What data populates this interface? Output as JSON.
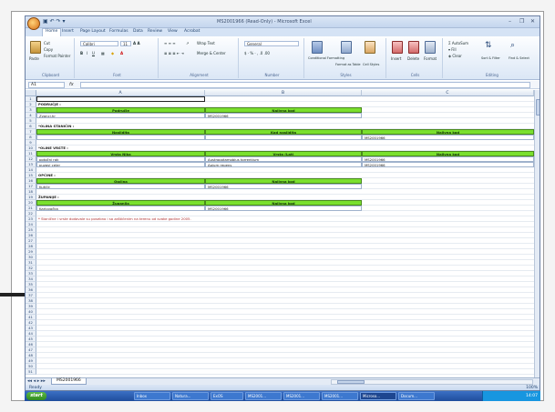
{
  "window": {
    "title": "MS2001966 (Read-Only) - Microsoft Excel",
    "quick_access": "▣ ↶ ↷ ▾",
    "controls": [
      "–",
      "❐",
      "✕"
    ]
  },
  "ribbon_tabs": [
    "Home",
    "Insert",
    "Page Layout",
    "Formulas",
    "Data",
    "Review",
    "View",
    "Acrobat"
  ],
  "ribbon": {
    "clipboard": {
      "paste": "Paste",
      "cut": "Cut",
      "copy": "Copy",
      "format_painter": "Format Painter",
      "label": "Clipboard"
    },
    "font": {
      "name": "Calibri",
      "size": "11",
      "label": "Font"
    },
    "alignment": {
      "wrap": "Wrap Text",
      "merge": "Merge & Center",
      "label": "Alignment"
    },
    "number": {
      "format": "General",
      "label": "Number"
    },
    "styles": {
      "conditional": "Conditional Formatting",
      "format_table": "Format as Table",
      "cell_styles": "Cell Styles",
      "label": "Styles"
    },
    "cells": {
      "insert": "Insert",
      "delete": "Delete",
      "format": "Format",
      "label": "Cells"
    },
    "editing": {
      "autosum": "AutoSum",
      "fill": "Fill",
      "clear": "Clear",
      "sort": "Sort & Filter",
      "find": "Find & Select",
      "label": "Editing"
    }
  },
  "formula_bar": {
    "cell_ref": "A1",
    "fx": "fx",
    "value": ""
  },
  "columns": [
    "A",
    "B",
    "C"
  ],
  "rows": [
    "1",
    "2",
    "3",
    "4",
    "5",
    "6",
    "7",
    "8",
    "9",
    "10",
    "11",
    "12",
    "13",
    "14",
    "15",
    "16",
    "17",
    "18",
    "19",
    "20",
    "21",
    "22",
    "23",
    "24",
    "25",
    "26",
    "27",
    "28",
    "29",
    "30",
    "31",
    "32",
    "33",
    "34",
    "35",
    "36",
    "37",
    "38",
    "39",
    "40",
    "41",
    "42",
    "43",
    "44",
    "45",
    "46",
    "47",
    "48",
    "49",
    "50",
    "51"
  ],
  "sheet": {
    "section1": {
      "title": "PODRUČJE :",
      "headers": [
        "Područje",
        "Nalivna kod"
      ],
      "row": [
        "Zvonci.hr",
        "MS2001966"
      ]
    },
    "section2": {
      "title": "*OLINA STANIČIN :",
      "headers": [
        "Naslidita",
        "Kod naslidita",
        "Nalivna kod"
      ],
      "row": [
        "",
        "",
        "MS2001966"
      ]
    },
    "section3": {
      "title": "*OLINE VRSTE :",
      "headers": [
        "Vrsta Nika",
        "Vrsta (Lat)",
        "Nalivna kod"
      ],
      "rows": [
        [
          "potočni rak",
          "Austropotamobius torrentium",
          "MS2001966"
        ],
        [
          "puzavi celer",
          "Apium repens",
          "MS2001966"
        ]
      ]
    },
    "section4": {
      "title": "OPĆINE :",
      "headers": [
        "Općina",
        "Nalivna kod"
      ],
      "row": [
        "Kutiće",
        "MS2001966"
      ]
    },
    "section5": {
      "title": "ŽUPANIJE :",
      "headers": [
        "Županija",
        "Nalivna kod"
      ],
      "row": [
        "Karlovačka",
        "MS2001966"
      ]
    },
    "note": "* Stanične i vrste dodavale su posebno i sa zaštićenim na terenu od svake godine 2005."
  },
  "sheet_tabs": {
    "nav": "◂◂ ◂ ▸ ▸▸",
    "active": "MS2001966"
  },
  "status": {
    "text": "Ready",
    "zoom": "100%"
  },
  "taskbar": {
    "start": "start",
    "buttons": [
      "Inbox",
      "Natura...",
      "ExOS",
      "MS2001...",
      "MS2001...",
      "MS2001...",
      "Microso...",
      "Docum..."
    ],
    "clock": "14:07"
  },
  "colors": {
    "header_green": "#7ae02e",
    "grid_border": "#9fb2cc",
    "ribbon_blue": "#dbe6f5"
  }
}
